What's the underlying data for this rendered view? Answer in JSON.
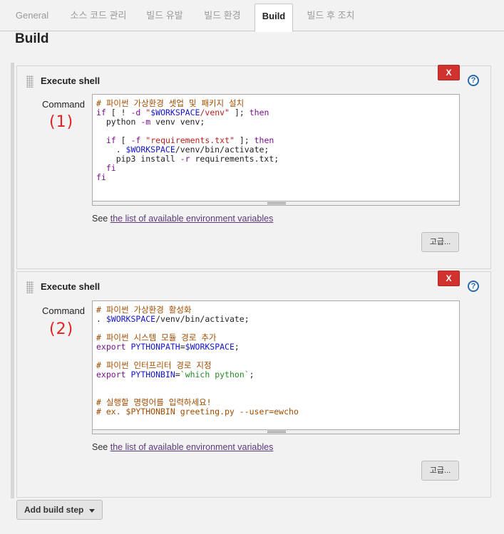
{
  "tabs": [
    {
      "label": "General"
    },
    {
      "label": "소스 코드 관리"
    },
    {
      "label": "빌드 유발"
    },
    {
      "label": "빌드 환경"
    },
    {
      "label": "Build"
    },
    {
      "label": "빌드 후 조치"
    }
  ],
  "page_title": "Build",
  "steps": [
    {
      "title": "Execute shell",
      "close_label": "X",
      "help_label": "?",
      "command_label": "Command",
      "annotation": "(1)",
      "see_prefix": "See ",
      "see_link": "the list of available environment variables",
      "advanced_label": "고급..."
    },
    {
      "title": "Execute shell",
      "close_label": "X",
      "help_label": "?",
      "command_label": "Command",
      "annotation": "(2)",
      "see_prefix": "See ",
      "see_link": "the list of available environment variables",
      "advanced_label": "고급..."
    }
  ],
  "add_build_step_label": "Add build step",
  "colors": {
    "close_button": "#d2322d",
    "annotation": "#e52222",
    "link": "#5c3a7a",
    "help_icon": "#2b6aa8"
  }
}
